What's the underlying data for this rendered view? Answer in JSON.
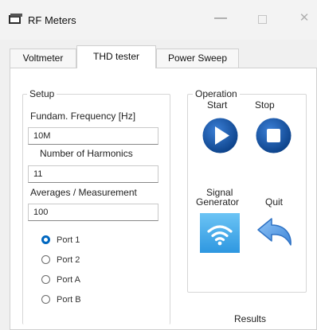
{
  "window": {
    "title": "RF Meters",
    "minimize_glyph": "—",
    "close_glyph": "✕"
  },
  "tabs": [
    {
      "label": "Voltmeter",
      "selected": false
    },
    {
      "label": "THD tester",
      "selected": true
    },
    {
      "label": "Power Sweep",
      "selected": false
    }
  ],
  "setup": {
    "title": "Setup",
    "frequency_label": "Fundam. Frequency [Hz]",
    "frequency_value": "10M",
    "harmonics_label": "Number of Harmonics",
    "harmonics_value": "11",
    "averages_label": "Averages / Measurement",
    "averages_value": "100",
    "ports": [
      {
        "label": "Port 1",
        "checked": true
      },
      {
        "label": "Port 2",
        "checked": false
      },
      {
        "label": "Port A",
        "checked": false
      },
      {
        "label": "Port B",
        "checked": false
      }
    ]
  },
  "operation": {
    "title": "Operation",
    "start_label": "Start",
    "stop_label": "Stop",
    "signal_generator_label_line1": "Signal",
    "signal_generator_label_line2": "Generator",
    "quit_label": "Quit"
  },
  "results_label": "Results",
  "icons": {
    "app": "app-window-icon",
    "start": "play-icon",
    "stop": "stop-icon",
    "signal_generator": "wifi-signal-icon",
    "quit": "return-arrow-icon"
  },
  "colors": {
    "accent": "#0067c0",
    "play_dark": "#0a3f86",
    "signal_blue": "#4fb3ee",
    "quit_blue": "#5a9ee6"
  }
}
